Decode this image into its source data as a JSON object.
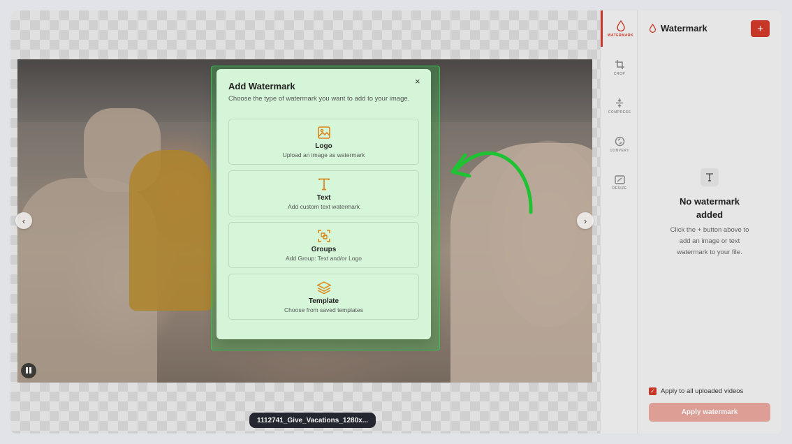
{
  "canvas": {
    "filename": "1112741_Give_Vacations_1280x..."
  },
  "tools": [
    {
      "label": "WATERMARK",
      "icon": "watermark-drop-icon",
      "active": true
    },
    {
      "label": "CROP",
      "icon": "crop-icon",
      "active": false
    },
    {
      "label": "COMPRESS",
      "icon": "compress-icon",
      "active": false
    },
    {
      "label": "CONVERT",
      "icon": "convert-icon",
      "active": false
    },
    {
      "label": "RESIZE",
      "icon": "resize-icon",
      "active": false
    }
  ],
  "panel": {
    "title": "Watermark",
    "add_label": "+",
    "empty_title": "No watermark added",
    "empty_desc": "Click the + button above to add an image or text watermark to your file.",
    "apply_all_label": "Apply to all uploaded videos",
    "apply_all_checked": true,
    "apply_button": "Apply watermark"
  },
  "modal": {
    "title": "Add Watermark",
    "subtitle": "Choose the type of watermark you want to add to your image.",
    "close": "×",
    "options": [
      {
        "title": "Logo",
        "desc": "Upload an image as watermark",
        "icon": "image-icon"
      },
      {
        "title": "Text",
        "desc": "Add custom text watermark",
        "icon": "text-icon"
      },
      {
        "title": "Groups",
        "desc": "Add Group: Text and/or Logo",
        "icon": "group-icon"
      },
      {
        "title": "Template",
        "desc": "Choose from saved templates",
        "icon": "layers-icon"
      }
    ]
  },
  "colors": {
    "accent": "#d13a2a",
    "option_icon": "#d9861a",
    "highlight": "#36c24d"
  }
}
